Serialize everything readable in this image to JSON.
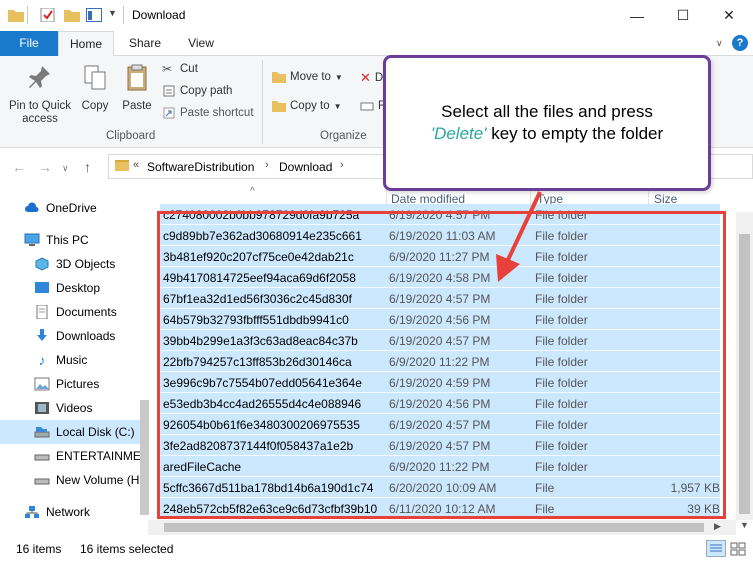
{
  "window": {
    "title": "Download",
    "minimize_glyph": "—",
    "maximize_glyph": "☐",
    "close_glyph": "✕"
  },
  "ribbon_tabs": [
    {
      "label": "File"
    },
    {
      "label": "Home"
    },
    {
      "label": "Share"
    },
    {
      "label": "View"
    }
  ],
  "ribbon": {
    "pin_label_1": "Pin to Quick",
    "pin_label_2": "access",
    "copy_label": "Copy",
    "paste_label": "Paste",
    "cut_label": "Cut",
    "copy_path_label": "Copy path",
    "paste_shortcut_label": "Paste shortcut",
    "clipboard_group": "Clipboard",
    "move_to_label": "Move to",
    "copy_to_label": "Copy to",
    "delete_partial": "D",
    "rename_partial": "R",
    "organize_group": "Organize"
  },
  "address": {
    "overflow": "«",
    "segments": [
      "SoftwareDistribution",
      "Download"
    ],
    "separator": "›"
  },
  "nav_pane": [
    {
      "label": "OneDrive",
      "icon": "cloud-icon"
    },
    {
      "label": "This PC",
      "icon": "computer-icon"
    },
    {
      "label": "3D Objects",
      "icon": "cube-icon"
    },
    {
      "label": "Desktop",
      "icon": "desktop-icon"
    },
    {
      "label": "Documents",
      "icon": "document-icon"
    },
    {
      "label": "Downloads",
      "icon": "download-arrow-icon"
    },
    {
      "label": "Music",
      "icon": "music-note-icon"
    },
    {
      "label": "Pictures",
      "icon": "picture-icon"
    },
    {
      "label": "Videos",
      "icon": "film-icon"
    },
    {
      "label": "Local Disk (C:)",
      "icon": "drive-icon"
    },
    {
      "label": "ENTERTAINMENT",
      "icon": "drive-icon"
    },
    {
      "label": "New Volume (H:",
      "icon": "drive-icon"
    },
    {
      "label": "Network",
      "icon": "network-icon"
    }
  ],
  "columns": {
    "date": "Date modified",
    "type": "Type",
    "size": "Size"
  },
  "files": [
    {
      "name": "c274080002b0bb978729d0fa9b725a",
      "date": "6/19/2020 4:57 PM",
      "type": "File folder",
      "size": ""
    },
    {
      "name": "c9d89bb7e362ad30680914e235c661",
      "date": "6/19/2020 11:03 AM",
      "type": "File folder",
      "size": ""
    },
    {
      "name": "3b481ef920c207cf75ce0e42dab21c",
      "date": "6/9/2020 11:27 PM",
      "type": "File folder",
      "size": ""
    },
    {
      "name": "49b4170814725eef94aca69d6f2058",
      "date": "6/19/2020 4:58 PM",
      "type": "File folder",
      "size": ""
    },
    {
      "name": "67bf1ea32d1ed56f3036c2c45d830f",
      "date": "6/19/2020 4:57 PM",
      "type": "File folder",
      "size": ""
    },
    {
      "name": "64b579b32793fbfff551dbdb9941c0",
      "date": "6/19/2020 4:56 PM",
      "type": "File folder",
      "size": ""
    },
    {
      "name": "39bb4b299e1a3f3c63ad8eac84c37b",
      "date": "6/19/2020 4:57 PM",
      "type": "File folder",
      "size": ""
    },
    {
      "name": "22bfb794257c13ff853b26d30146ca",
      "date": "6/9/2020 11:22 PM",
      "type": "File folder",
      "size": ""
    },
    {
      "name": "3e996c9b7c7554b07edd05641e364e",
      "date": "6/19/2020 4:59 PM",
      "type": "File folder",
      "size": ""
    },
    {
      "name": "e53edb3b4cc4ad26555d4c4e088946",
      "date": "6/19/2020 4:56 PM",
      "type": "File folder",
      "size": ""
    },
    {
      "name": "926054b0b61f6e3480300206975535",
      "date": "6/19/2020 4:57 PM",
      "type": "File folder",
      "size": ""
    },
    {
      "name": "3fe2ad8208737144f0f058437a1e2b",
      "date": "6/19/2020 4:57 PM",
      "type": "File folder",
      "size": ""
    },
    {
      "name": "aredFileCache",
      "date": "6/9/2020 11:22 PM",
      "type": "File folder",
      "size": ""
    },
    {
      "name": "5cffc3667d511ba178bd14b6a190d1c74",
      "date": "6/20/2020 10:09 AM",
      "type": "File",
      "size": "1,957 KB"
    },
    {
      "name": "248eb572cb5f82e63ce9c6d73cfbf39b10",
      "date": "6/11/2020 10:12 AM",
      "type": "File",
      "size": "39 KB"
    }
  ],
  "status": {
    "item_count": "16 items",
    "selected_count": "16 items selected"
  },
  "callout": {
    "line1": "Select all the files and press",
    "quote_open": "'",
    "highlight": "Delete",
    "quote_close": "'",
    "line2_rest": " key to empty the folder"
  },
  "colors": {
    "accent": "#1979ca",
    "selection": "#cce8ff",
    "highlight_box": "#e8403a",
    "callout_border": "#6a3d99",
    "callout_highlight": "#2aa6a0"
  }
}
